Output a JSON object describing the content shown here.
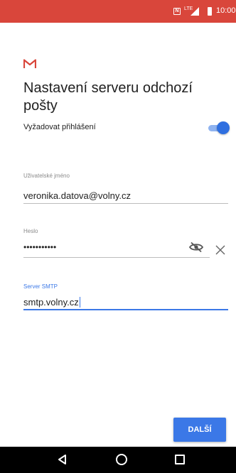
{
  "status_bar": {
    "background": "#d9463b",
    "nfc_icon": "N",
    "network": "LTE",
    "time": "10:00"
  },
  "header": {
    "logo_icon": "gmail-icon",
    "title": "Nastavení serveru odchozí pošty"
  },
  "login_toggle": {
    "label": "Vyžadovat přihlášení",
    "enabled": true
  },
  "username": {
    "label": "Uživatelské jméno",
    "value": "veronika.datova@volny.cz"
  },
  "password": {
    "label": "Heslo",
    "value": "•••••••••••",
    "toggle_visibility_icon": "eye-off-icon",
    "clear_icon": "close-icon"
  },
  "smtp_server": {
    "label": "Server SMTP",
    "value": "smtp.volny.cz"
  },
  "actions": {
    "next_label": "DALŠÍ"
  },
  "colors": {
    "accent": "#3b78e7",
    "brand_red": "#d9463b"
  },
  "nav_bar": {
    "back_icon": "back-triangle-icon",
    "home_icon": "home-circle-icon",
    "recent_icon": "recents-square-icon"
  }
}
